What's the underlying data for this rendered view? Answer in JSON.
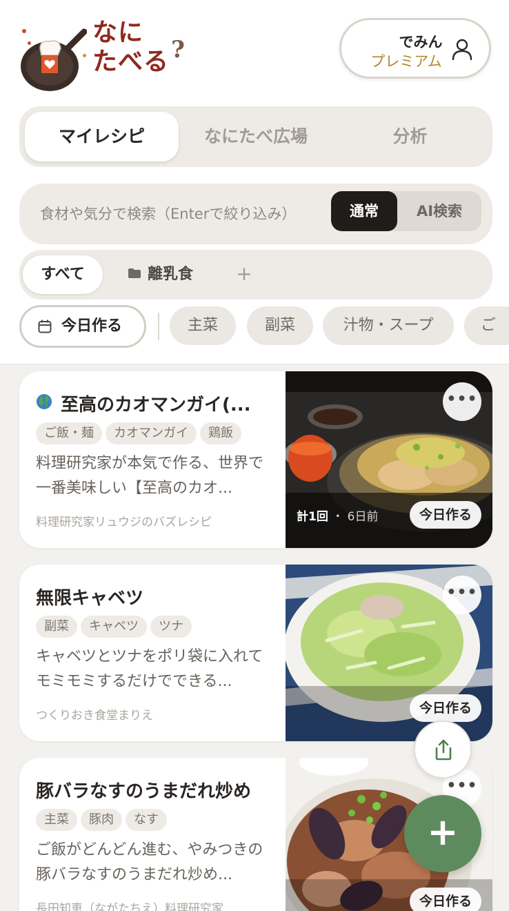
{
  "logo": {
    "line1": "なに",
    "line2": "たべる",
    "mark": "?"
  },
  "user": {
    "name": "でみん",
    "plan": "プレミアム",
    "icon": "person-icon"
  },
  "tabs": [
    {
      "label": "マイレシピ",
      "active": true
    },
    {
      "label": "なにたべ広場",
      "active": false
    },
    {
      "label": "分析",
      "active": false
    }
  ],
  "search": {
    "placeholder": "食材や気分で検索（Enterで絞り込み）",
    "modes": [
      {
        "label": "通常",
        "active": true
      },
      {
        "label": "AI検索",
        "active": false
      }
    ]
  },
  "folders": {
    "all": "すべて",
    "items": [
      {
        "label": "離乳食",
        "icon": "folder-icon"
      }
    ],
    "add": "+"
  },
  "filters": {
    "today": "今日作る",
    "chips": [
      "主菜",
      "副菜",
      "汁物・スープ",
      "ご"
    ]
  },
  "recipes": [
    {
      "title": "至高のカオマンガイ(...",
      "globe": true,
      "tags": [
        "ご飯・麺",
        "カオマンガイ",
        "鶏飯"
      ],
      "description": "料理研究家が本気で作る、世界で一番美味しい【至高のカオ...",
      "source": "料理研究家リュウジのバズレシピ",
      "count": "計1回",
      "separator": "・",
      "last_made": "6日前",
      "today_label": "今日作る"
    },
    {
      "title": "無限キャベツ",
      "globe": false,
      "tags": [
        "副菜",
        "キャベツ",
        "ツナ"
      ],
      "description": "キャベツとツナをポリ袋に入れてモミモミするだけでできる...",
      "source": "つくりおき食堂まりえ",
      "today_label": "今日作る"
    },
    {
      "title": "豚バラなすのうまだれ炒め",
      "globe": false,
      "tags": [
        "主菜",
        "豚肉",
        "なす"
      ],
      "description": "ご飯がどんどん進む、やみつきの豚バラなすのうまだれ炒め...",
      "source": "長田知恵（ながたちえ）料理研究家...",
      "today_label": "今日作る"
    }
  ],
  "more_label": "•••",
  "fab_label": "+",
  "colors": {
    "accent_green": "#5e8b5d",
    "premium_gold": "#b2862c",
    "logo_red": "#8f2a1e"
  }
}
